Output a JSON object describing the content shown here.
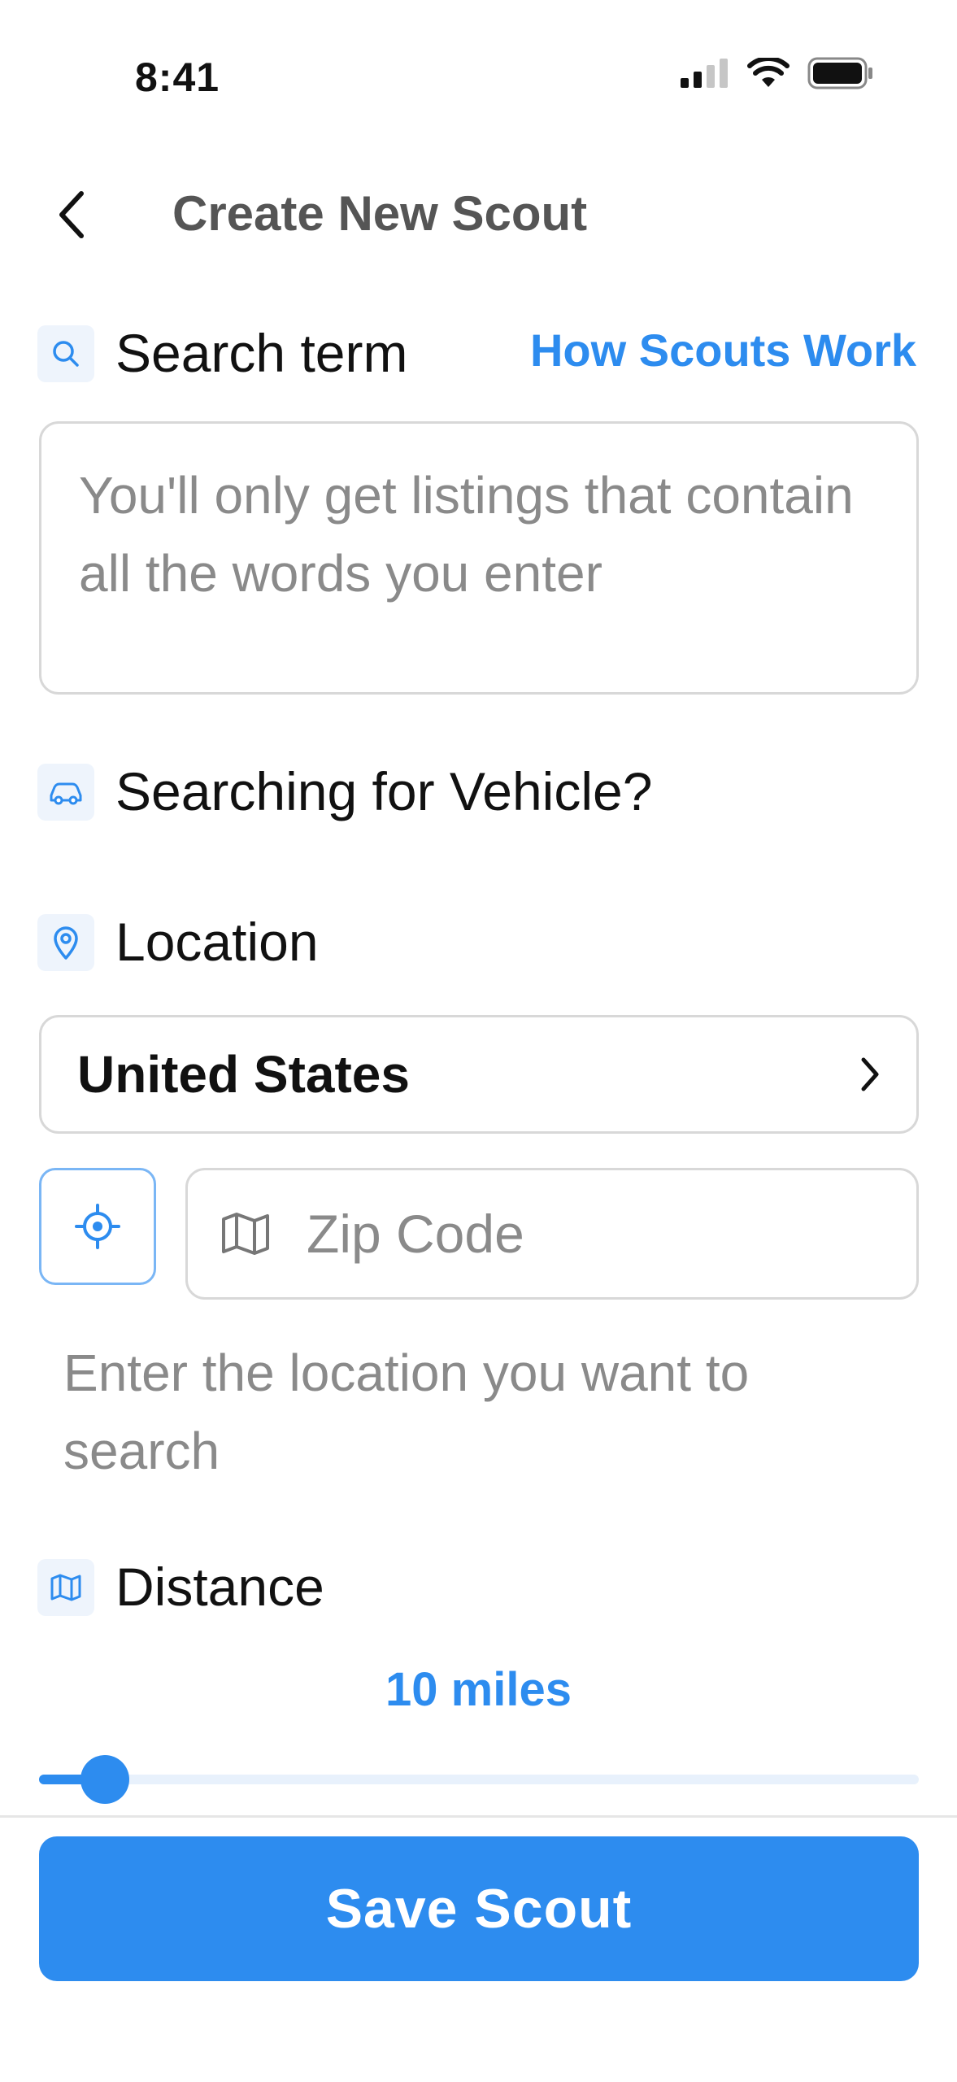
{
  "status_bar": {
    "time": "8:41"
  },
  "header": {
    "title": "Create New Scout",
    "back_icon": "chevron-left-icon"
  },
  "search_term": {
    "label": "Search term",
    "link_label": "How Scouts Work",
    "placeholder": "You'll only get listings that contain all the words you enter",
    "icon": "search-icon"
  },
  "vehicle": {
    "label": "Searching for Vehicle?",
    "icon": "car-icon"
  },
  "location": {
    "label": "Location",
    "icon": "map-pin-icon",
    "country": "United States",
    "zip_placeholder": "Zip Code",
    "helper": "Enter the location you want to search"
  },
  "distance": {
    "label": "Distance",
    "icon": "map-icon",
    "value_text": "10 miles",
    "slider_fraction": 0.075
  },
  "footer": {
    "save_label": "Save Scout"
  },
  "colors": {
    "accent": "#2d8cef",
    "icon_bg": "#eef4fc",
    "placeholder": "#8a8a8a"
  }
}
